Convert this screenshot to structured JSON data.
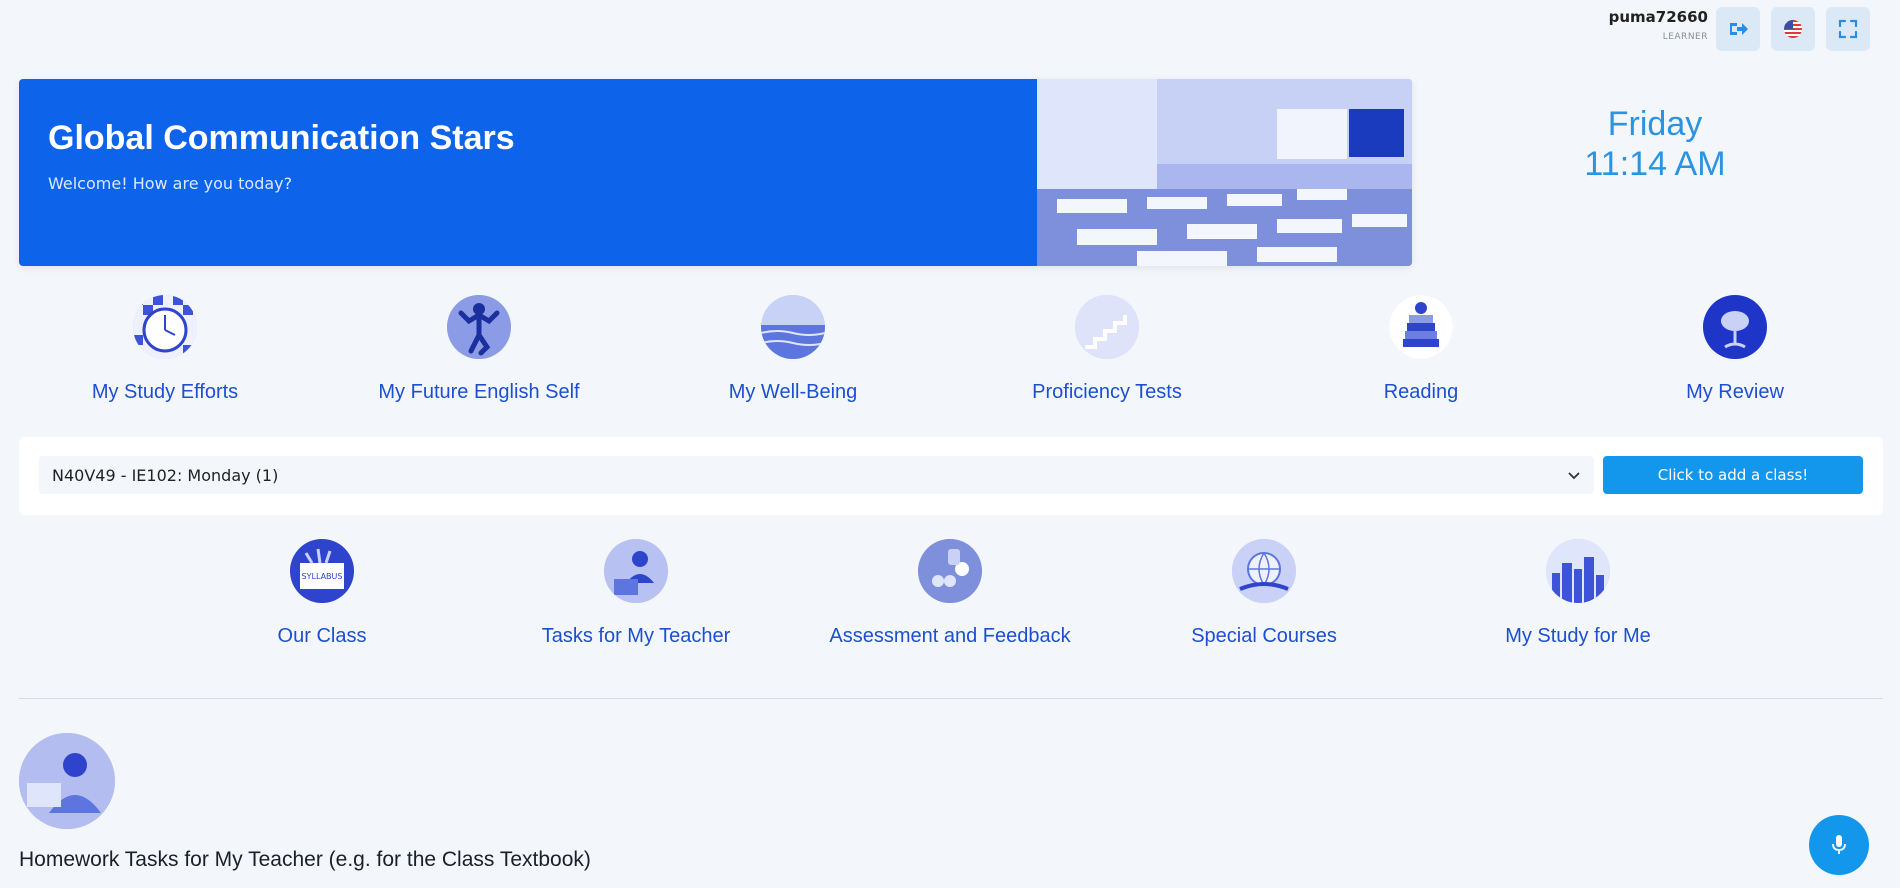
{
  "user": {
    "name": "puma72660",
    "role": "LEARNER"
  },
  "topbar": {
    "logout_icon": "logout-icon",
    "language_icon": "us-flag-icon",
    "fullscreen_icon": "fullscreen-icon"
  },
  "hero": {
    "title": "Global Communication Stars",
    "subtitle": "Welcome! How are you today?"
  },
  "clock": {
    "day": "Friday",
    "time": "11:14 AM"
  },
  "main_tiles": [
    {
      "label": "My Study Efforts"
    },
    {
      "label": "My Future English Self"
    },
    {
      "label": "My Well-Being"
    },
    {
      "label": "Proficiency Tests"
    },
    {
      "label": "Reading"
    },
    {
      "label": "My Review"
    }
  ],
  "class_selector": {
    "selected": "N40V49 - IE102: Monday (1)",
    "add_button": "Click to add a class!"
  },
  "class_tiles": [
    {
      "label": "Our Class"
    },
    {
      "label": "Tasks for My Teacher"
    },
    {
      "label": "Assessment and Feedback"
    },
    {
      "label": "Special Courses"
    },
    {
      "label": "My Study for Me"
    }
  ],
  "homework": {
    "heading": "Homework Tasks for My Teacher (e.g. for the Class Textbook)"
  },
  "colors": {
    "primary": "#0d64ea",
    "accent": "#1397ed",
    "tile_text": "#1d4fcf",
    "clock": "#2b93e0"
  }
}
